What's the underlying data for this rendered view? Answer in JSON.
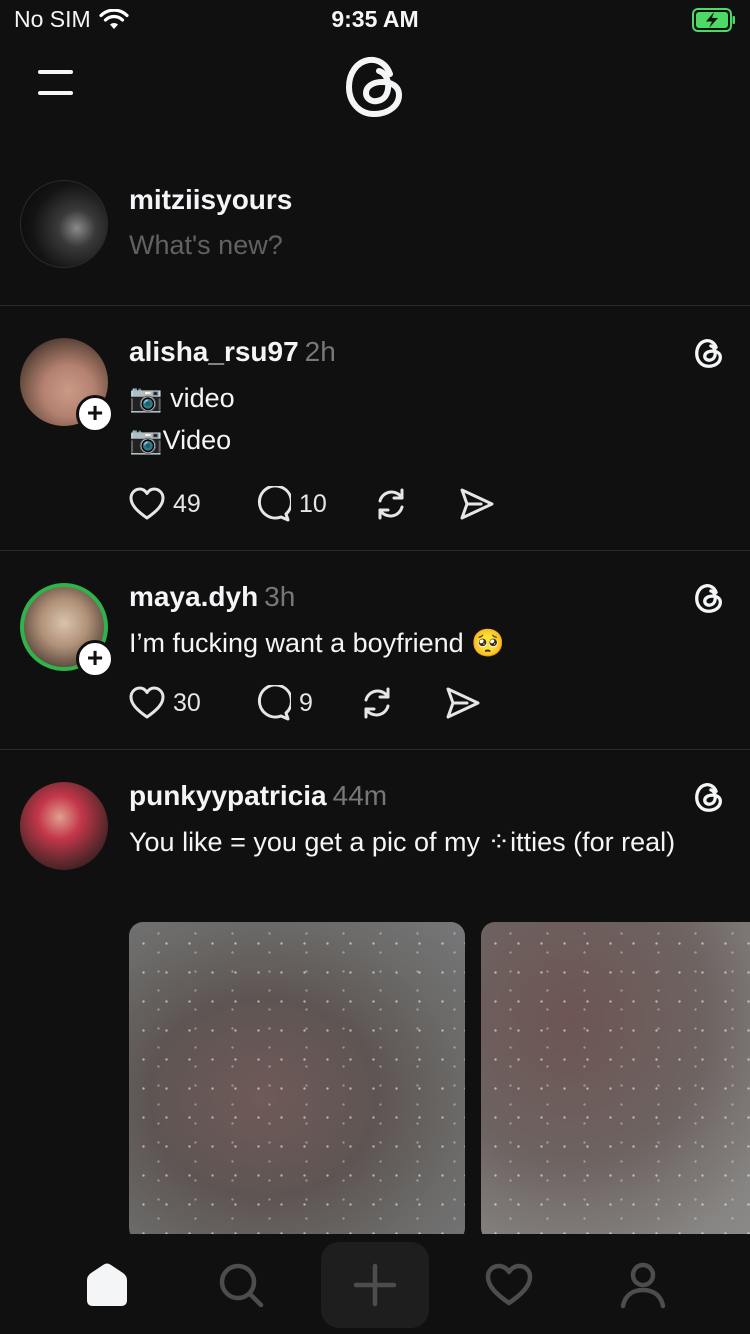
{
  "status_bar": {
    "carrier": "No SIM",
    "time": "9:35 AM",
    "icons": [
      "wifi-icon",
      "battery-charging-icon"
    ],
    "battery_color": "#4cd964"
  },
  "header": {
    "icons": [
      "menu-icon",
      "threads-logo"
    ]
  },
  "composer": {
    "username": "mitziisyours",
    "placeholder": "What's new?"
  },
  "posts": [
    {
      "username": "alisha_rsu97",
      "time": "2h",
      "lines": [
        "📷 video",
        "📷Video"
      ],
      "likes": "49",
      "replies": "10"
    },
    {
      "username": "maya.dyh",
      "time": "3h",
      "lines": [
        "I’m fucking want a boyfriend 🥺"
      ],
      "likes": "30",
      "replies": "9",
      "avatar_ring_color": "#2fb34a"
    },
    {
      "username": "punkyypatricia",
      "time": "44m",
      "lines": [
        "You like = you get a pic of my ⁘itties (for real)"
      ],
      "photos": 2
    }
  ],
  "tabbar": {
    "tabs": [
      "home-icon",
      "search-icon",
      "create-icon",
      "activity-heart-icon",
      "profile-icon"
    ]
  },
  "colors": {
    "background": "#101010",
    "text": "#f3f5f7",
    "muted": "#777777",
    "divider": "#2a2a2a"
  }
}
